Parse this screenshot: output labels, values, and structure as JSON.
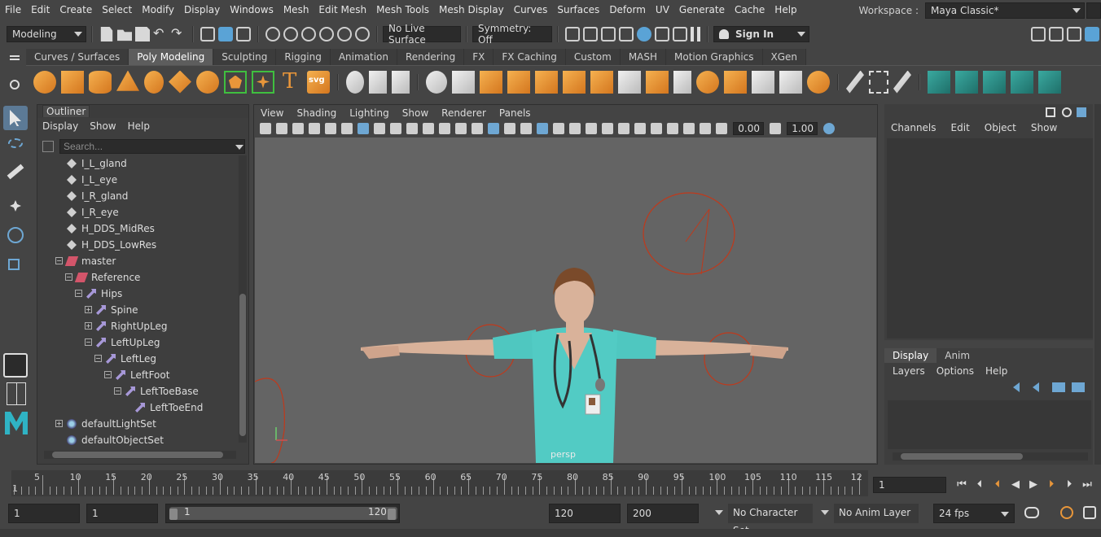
{
  "menubar": {
    "items": [
      "File",
      "Edit",
      "Create",
      "Select",
      "Modify",
      "Display",
      "Windows",
      "Mesh",
      "Edit Mesh",
      "Mesh Tools",
      "Mesh Display",
      "Curves",
      "Surfaces",
      "Deform",
      "UV",
      "Generate",
      "Cache",
      "Help"
    ],
    "workspace_label": "Workspace :",
    "workspace_value": "Maya Classic*"
  },
  "statusline": {
    "mode": "Modeling",
    "live_surface": "No Live Surface",
    "symmetry": "Symmetry: Off",
    "sign_in": "Sign In"
  },
  "shelf": {
    "tabs": [
      "Curves / Surfaces",
      "Poly Modeling",
      "Sculpting",
      "Rigging",
      "Animation",
      "Rendering",
      "FX",
      "FX Caching",
      "Custom",
      "MASH",
      "Motion Graphics",
      "XGen"
    ],
    "active_tab": "Poly Modeling",
    "text_icons": [
      "T",
      "svg"
    ]
  },
  "outliner": {
    "title": "Outliner",
    "menu": [
      "Display",
      "Show",
      "Help"
    ],
    "search_placeholder": "Search...",
    "nodes": [
      "I_L_gland",
      "I_L_eye",
      "I_R_gland",
      "I_R_eye",
      "H_DDS_MidRes",
      "H_DDS_LowRes",
      "master",
      "Reference",
      "Hips",
      "Spine",
      "RightUpLeg",
      "LeftUpLeg",
      "LeftLeg",
      "LeftFoot",
      "LeftToeBase",
      "LeftToeEnd",
      "defaultLightSet",
      "defaultObjectSet"
    ]
  },
  "viewport": {
    "menu": [
      "View",
      "Shading",
      "Lighting",
      "Show",
      "Renderer",
      "Panels"
    ],
    "field_a": "0.00",
    "field_b": "1.00",
    "camera_label": "persp"
  },
  "channelbox": {
    "menu": [
      "Channels",
      "Edit",
      "Object",
      "Show"
    ]
  },
  "layers": {
    "tabs": [
      "Display",
      "Anim"
    ],
    "menu": [
      "Layers",
      "Options",
      "Help"
    ]
  },
  "timeline": {
    "ticks": [
      5,
      10,
      15,
      20,
      25,
      30,
      35,
      40,
      45,
      50,
      55,
      60,
      65,
      70,
      75,
      80,
      85,
      90,
      95,
      100,
      105,
      110,
      115,
      12
    ],
    "start_marker": "1",
    "current_frame": "1"
  },
  "range": {
    "start": "1",
    "playback_start": "1",
    "slider_low": "1",
    "slider_high": "120",
    "playback_end": "120",
    "end": "200",
    "character_set": "No Character Set",
    "anim_layer": "No Anim Layer",
    "fps": "24 fps"
  },
  "colors": {
    "accent_blue": "#5c7a96",
    "shelf_orange": "#e8963a",
    "shelf_teal": "#2f958c",
    "rig_red": "#c0391b"
  }
}
